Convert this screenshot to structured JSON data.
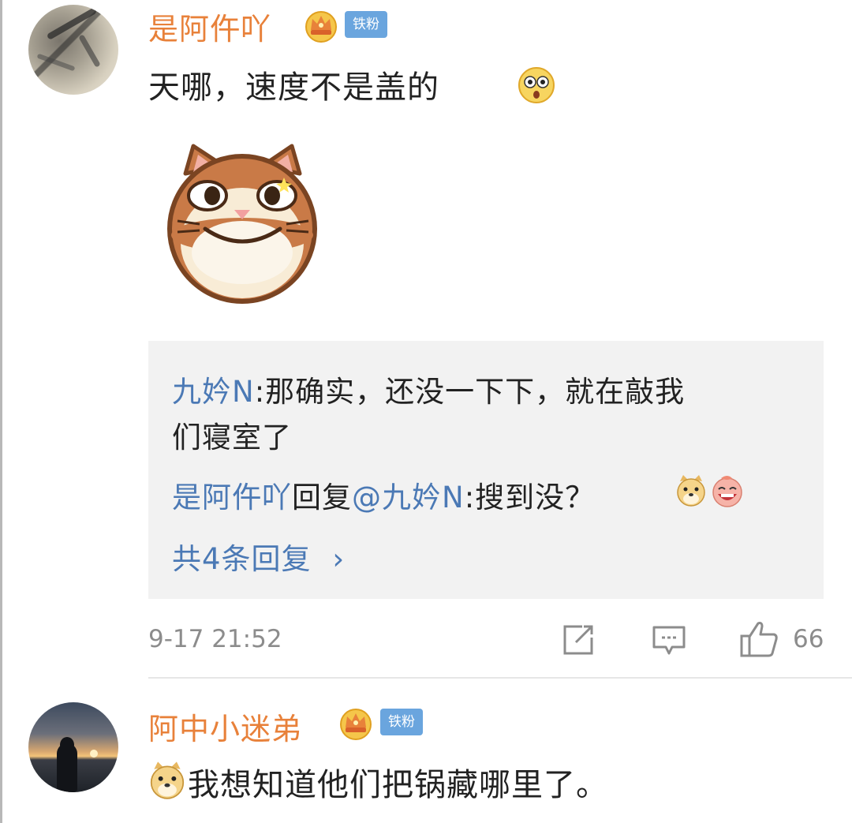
{
  "comment1": {
    "username": "是阿仵吖",
    "badge": "铁粉",
    "text": "天哪，速度不是盖的",
    "replies": {
      "line1_author": "九妗N",
      "line1_text_a": ":那确实，还没一下下，就在敲我",
      "line1_text_b": "们寝室了",
      "line2_author": "是阿仵吖",
      "line2_reply": "回复",
      "line2_at": "@九妗N",
      "line2_text": ":搜到没？",
      "more_label": "共4条回复",
      "more_chevron": "›"
    },
    "timestamp": "9-17 21:52",
    "like_count": "66",
    "icons": [
      "forward-icon",
      "comment-icon",
      "like-icon",
      "crown-icon",
      "surprised-emoji",
      "cat-sticker",
      "doge-emoji",
      "laugh-emoji"
    ]
  },
  "comment2": {
    "username": "阿中小迷弟",
    "badge": "铁粉",
    "text": "我想知道他们把锅藏哪里了。"
  },
  "colors": {
    "username": "#e8813a",
    "link_blue": "#4b79b5",
    "badge_blue": "#6aa5de",
    "reply_bg": "#f2f2f2",
    "meta_gray": "#8c8c8c"
  }
}
